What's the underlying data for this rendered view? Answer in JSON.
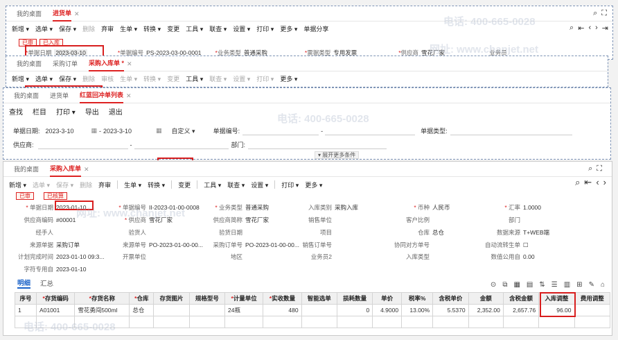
{
  "watermark": {
    "phone": "电话: 400-665-0028",
    "site": "网址: www.chanjet.net"
  },
  "win1": {
    "tabs": [
      {
        "label": "我的桌面"
      },
      {
        "label": "进货单",
        "active": true
      }
    ],
    "toolbar": [
      "新增 ▾",
      "选单 ▾",
      "保存 ▾",
      "删除",
      "弃审",
      "生单 ▾",
      "转换 ▾",
      "变更",
      "工具 ▾",
      "联查 ▾",
      "设置 ▾",
      "打印 ▾",
      "更多 ▾",
      "单据分享"
    ],
    "badges": [
      "已审",
      "已入库"
    ],
    "fields": {
      "date_label": "单据日期",
      "date": "2023-03-10",
      "code_label": "单据编号",
      "code": "PS-2023-03-00-0001",
      "biz_label": "业务类型",
      "biz": "普通采购",
      "inv_label": "票据类型",
      "inv": "专用发票",
      "sup_label": "供应商",
      "sup": "雪花厂家",
      "staff_label": "业务员"
    }
  },
  "win2": {
    "tabs": [
      {
        "label": "我的桌面"
      },
      {
        "label": "采购订单"
      },
      {
        "label": "采购入库单 *",
        "active": true
      }
    ],
    "toolbar": [
      "新增 ▾",
      "选单 ▾",
      "保存 ▾",
      "删除",
      "审核",
      "生单 ▾",
      "转换 ▾",
      "变更",
      "工具 ▾",
      "联查 ▾",
      "设置 ▾",
      "打印 ▾",
      "更多 ▾"
    ]
  },
  "win3": {
    "tabs": [
      {
        "label": "我的桌面"
      },
      {
        "label": "进货单"
      },
      {
        "label": "红蓝回冲单列表",
        "active": true
      }
    ],
    "toolbar": [
      "查找",
      "栏目",
      "打印 ▾",
      "导出",
      "退出"
    ],
    "filter": {
      "date_label": "单据日期:",
      "date_from": "2023-3-10",
      "dash": "-",
      "date_to": "2023-3-10",
      "mode": "自定义 ▾",
      "code_label": "单据编号:",
      "code_dash": "-",
      "type_label": "单据类型:",
      "sup_label": "供应商:",
      "sup_dash": "-",
      "dept_label": "部门:",
      "expand": "▾ 展开更多条件"
    }
  },
  "win4": {
    "tabs": [
      {
        "label": "我的桌面"
      },
      {
        "label": "采购入库单",
        "active": true
      }
    ],
    "toolbar": [
      "新增 ▾",
      "选单 ▾",
      "保存 ▾",
      "删除",
      "弃审",
      "生单 ▾",
      "转换 ▾",
      "变更",
      "工具 ▾",
      "联查 ▾",
      "设置 ▾",
      "打印 ▾",
      "更多 ▾"
    ],
    "badges": [
      "已审",
      "已核算"
    ],
    "form": {
      "r1": [
        {
          "label": "单据日期",
          "value": "2023-01-10",
          "req": true
        },
        {
          "label": "单据编号",
          "value": "II-2023-01-00-0008",
          "req": true
        },
        {
          "label": "业务类型",
          "value": "普通采购",
          "req": true
        },
        {
          "label": "入库类别",
          "value": "采购入库"
        },
        {
          "label": "币种",
          "value": "人民币",
          "req": true
        },
        {
          "label": "汇率",
          "value": "1.0000",
          "req": true
        }
      ],
      "r2": [
        {
          "label": "供应商编码",
          "value": "#00001"
        },
        {
          "label": "供应商",
          "value": "雪花厂家",
          "req": true
        },
        {
          "label": "供应商简称",
          "value": "雪花厂家"
        },
        {
          "label": "销售单位",
          "value": ""
        },
        {
          "label": "客户比例",
          "value": ""
        },
        {
          "label": "部门",
          "value": ""
        }
      ],
      "r3": [
        {
          "label": "经手人",
          "value": ""
        },
        {
          "label": "验货人",
          "value": ""
        },
        {
          "label": "验货日期",
          "value": ""
        },
        {
          "label": "项目",
          "value": ""
        },
        {
          "label": "仓库",
          "value": "总仓"
        },
        {
          "label": "数据来源",
          "value": "T+WEB端"
        }
      ],
      "r4": [
        {
          "label": "来源单据",
          "value": "采购订单"
        },
        {
          "label": "来源单号",
          "value": "PO-2023-01-00-00..."
        },
        {
          "label": "采购订单号",
          "value": "PO-2023-01-00-00..."
        },
        {
          "label": "销售订单号",
          "value": ""
        },
        {
          "label": "协同对方单号",
          "value": ""
        },
        {
          "label": "自动流转生单",
          "value": "☐"
        }
      ],
      "r5": [
        {
          "label": "计划完成时间",
          "value": "2023-01-10 09:3..."
        },
        {
          "label": "开票单位",
          "value": ""
        },
        {
          "label": "地区",
          "value": ""
        },
        {
          "label": "业务员2",
          "value": ""
        },
        {
          "label": "入库类型",
          "value": ""
        },
        {
          "label": "数值公用自",
          "value": "0.00"
        }
      ],
      "r6": [
        {
          "label": "字符专用自",
          "value": "2023-01-10"
        }
      ]
    },
    "detail_tabs": [
      "明细",
      "汇总"
    ],
    "table": {
      "headers": [
        "序号",
        "存货编码",
        "存货名称",
        "仓库",
        "存货图片",
        "规格型号",
        "计量单位",
        "实收数量",
        "智能选单",
        "损耗数量",
        "单价",
        "税率%",
        "含税单价",
        "金额",
        "含税金额",
        "入库调整",
        "费用调整"
      ],
      "rows": [
        [
          "1",
          "A01001",
          "雪花勇闯500ml",
          "总仓",
          "",
          "",
          "24瓶",
          "480",
          "",
          "0",
          "4.9000",
          "13.00%",
          "5.5370",
          "2,352.00",
          "2,657.76",
          "96.00",
          ""
        ]
      ]
    }
  }
}
